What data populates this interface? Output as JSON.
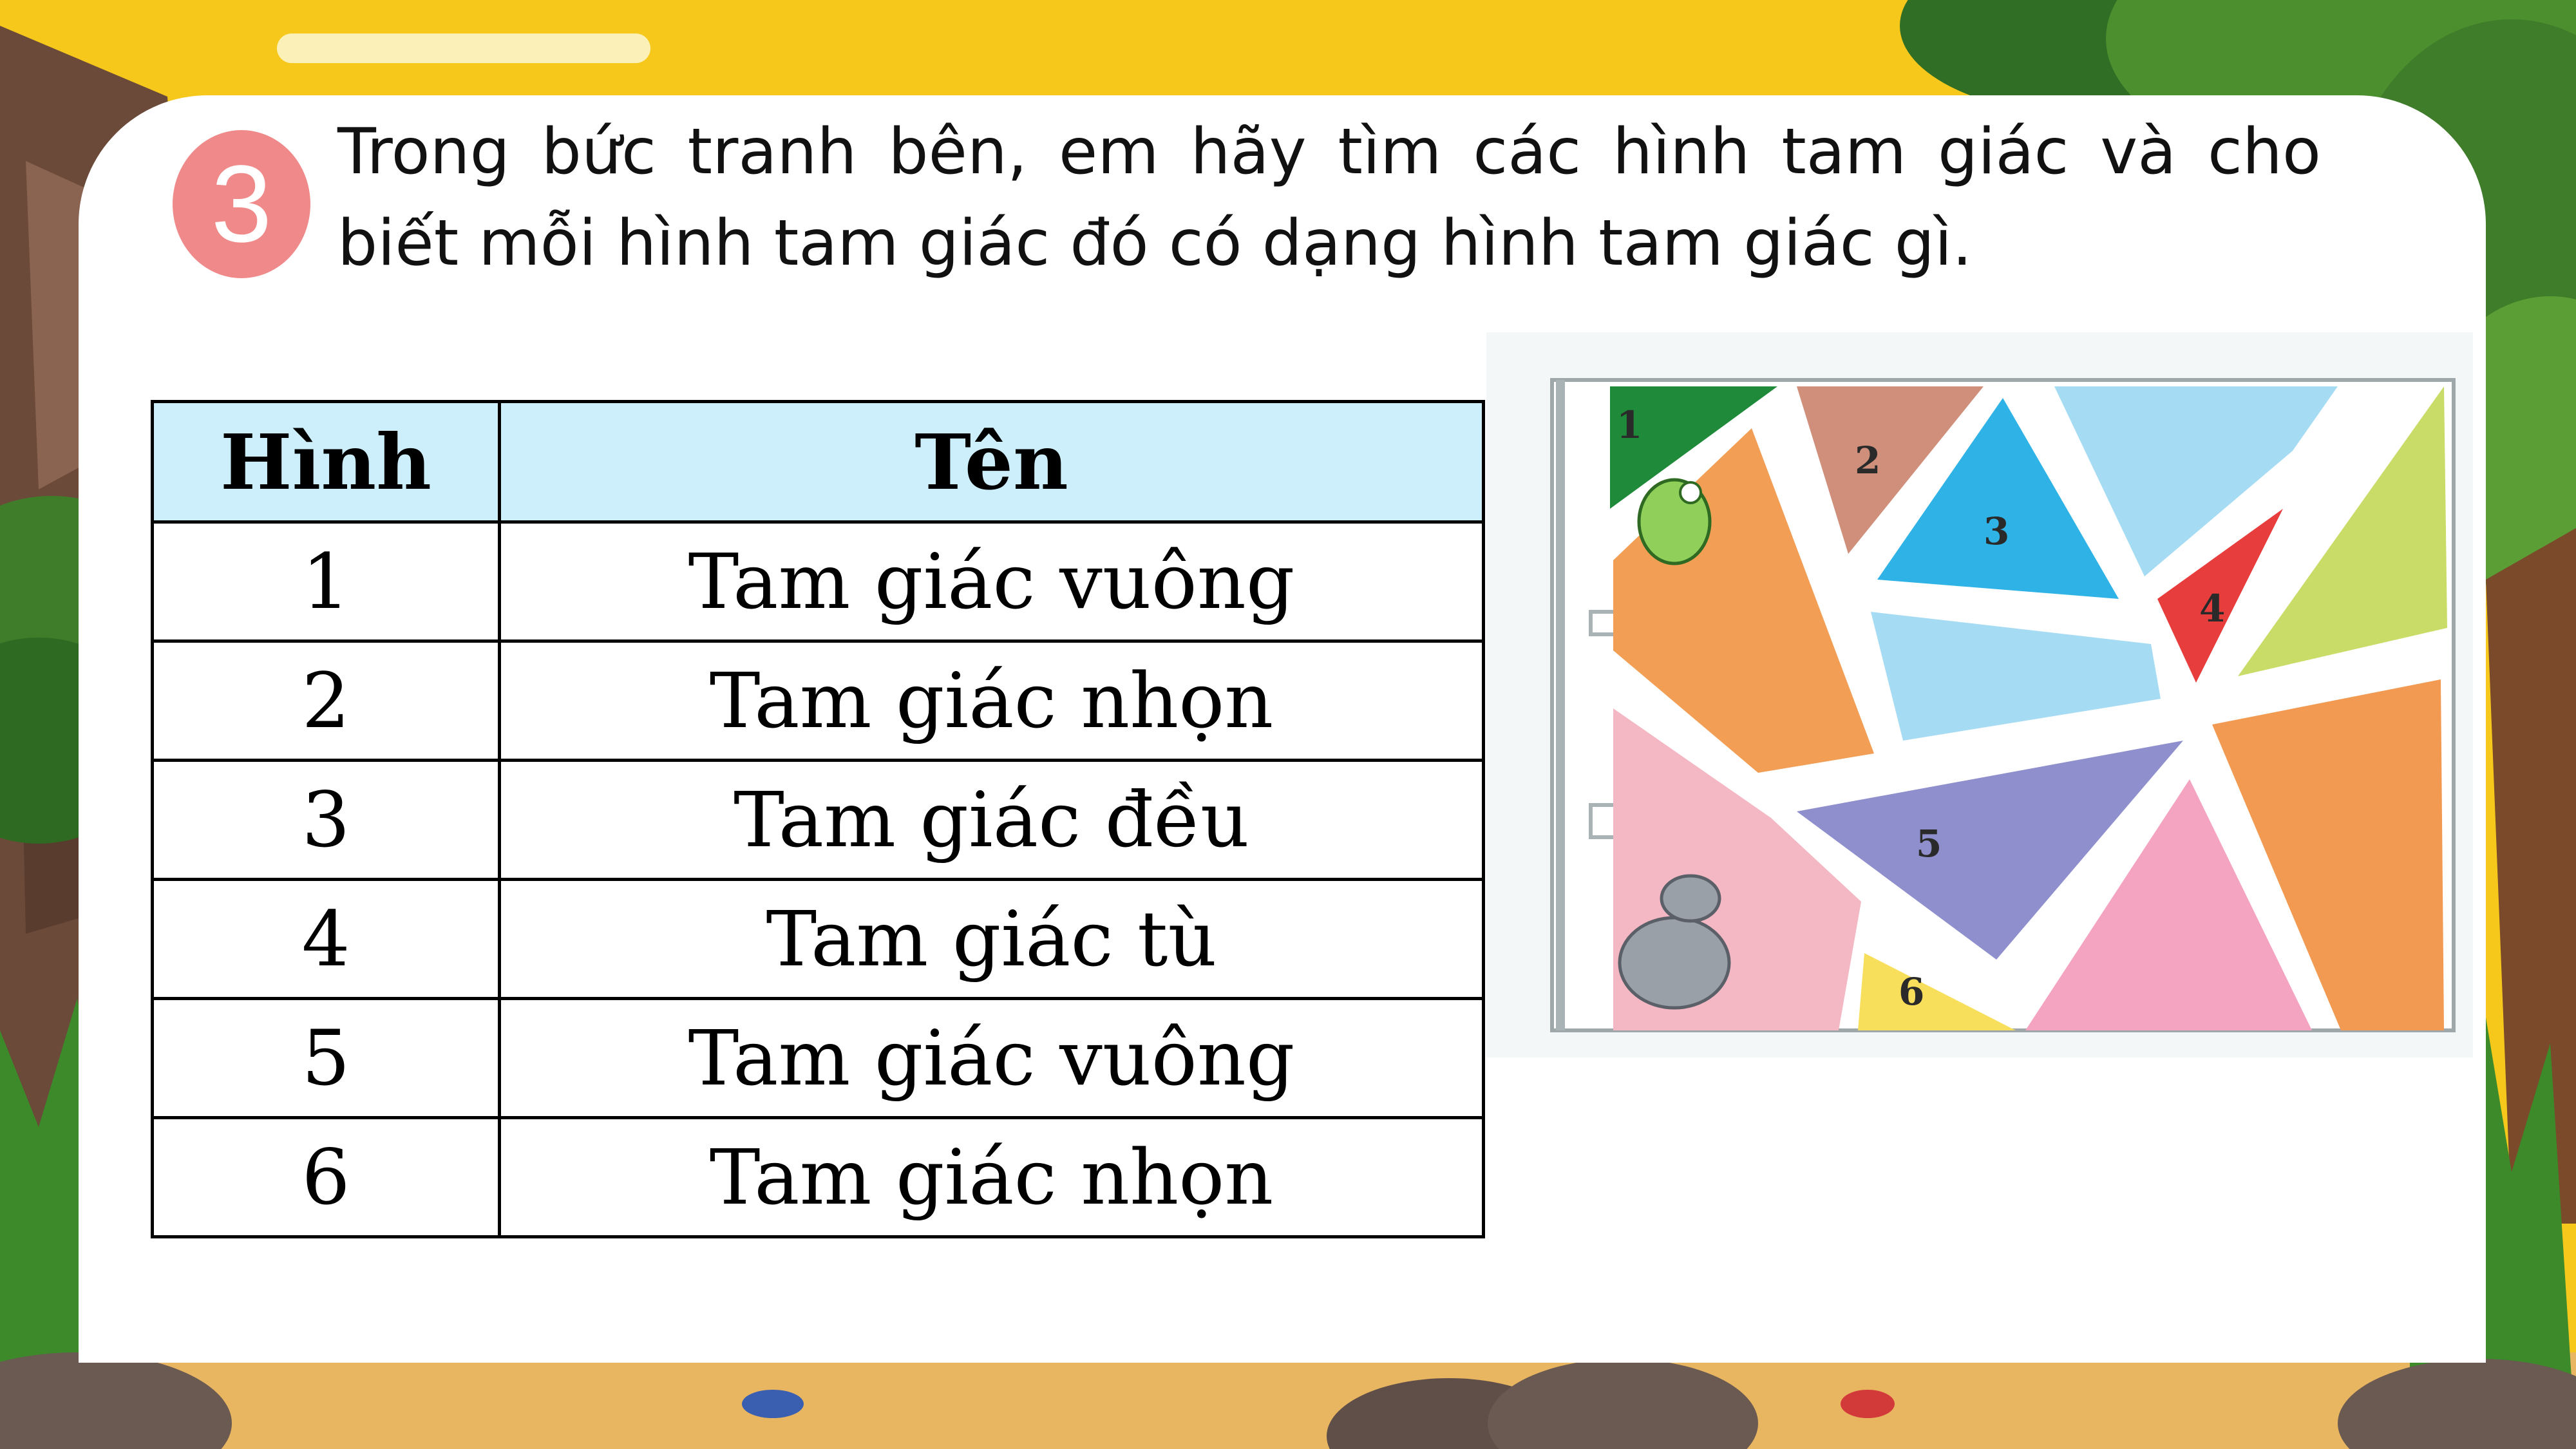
{
  "lesson": {
    "number": "3",
    "question": "Trong bức tranh bên, em hãy tìm các hình tam giác và cho biết mỗi hình tam giác đó có dạng hình tam giác gì."
  },
  "table": {
    "headers": [
      "Hình",
      "Tên"
    ],
    "rows": [
      {
        "hinh": "1",
        "ten": "Tam giác vuông"
      },
      {
        "hinh": "2",
        "ten": "Tam giác nhọn"
      },
      {
        "hinh": "3",
        "ten": "Tam giác đều"
      },
      {
        "hinh": "4",
        "ten": "Tam giác tù"
      },
      {
        "hinh": "5",
        "ten": "Tam giác vuông"
      },
      {
        "hinh": "6",
        "ten": "Tam giác nhọn"
      }
    ]
  },
  "figure": {
    "labels": [
      "1",
      "2",
      "3",
      "4",
      "5",
      "6"
    ]
  },
  "colors": {
    "sky": "#f6c81c",
    "badge": "#f08a8a",
    "header_fill": "#cdeefb"
  }
}
